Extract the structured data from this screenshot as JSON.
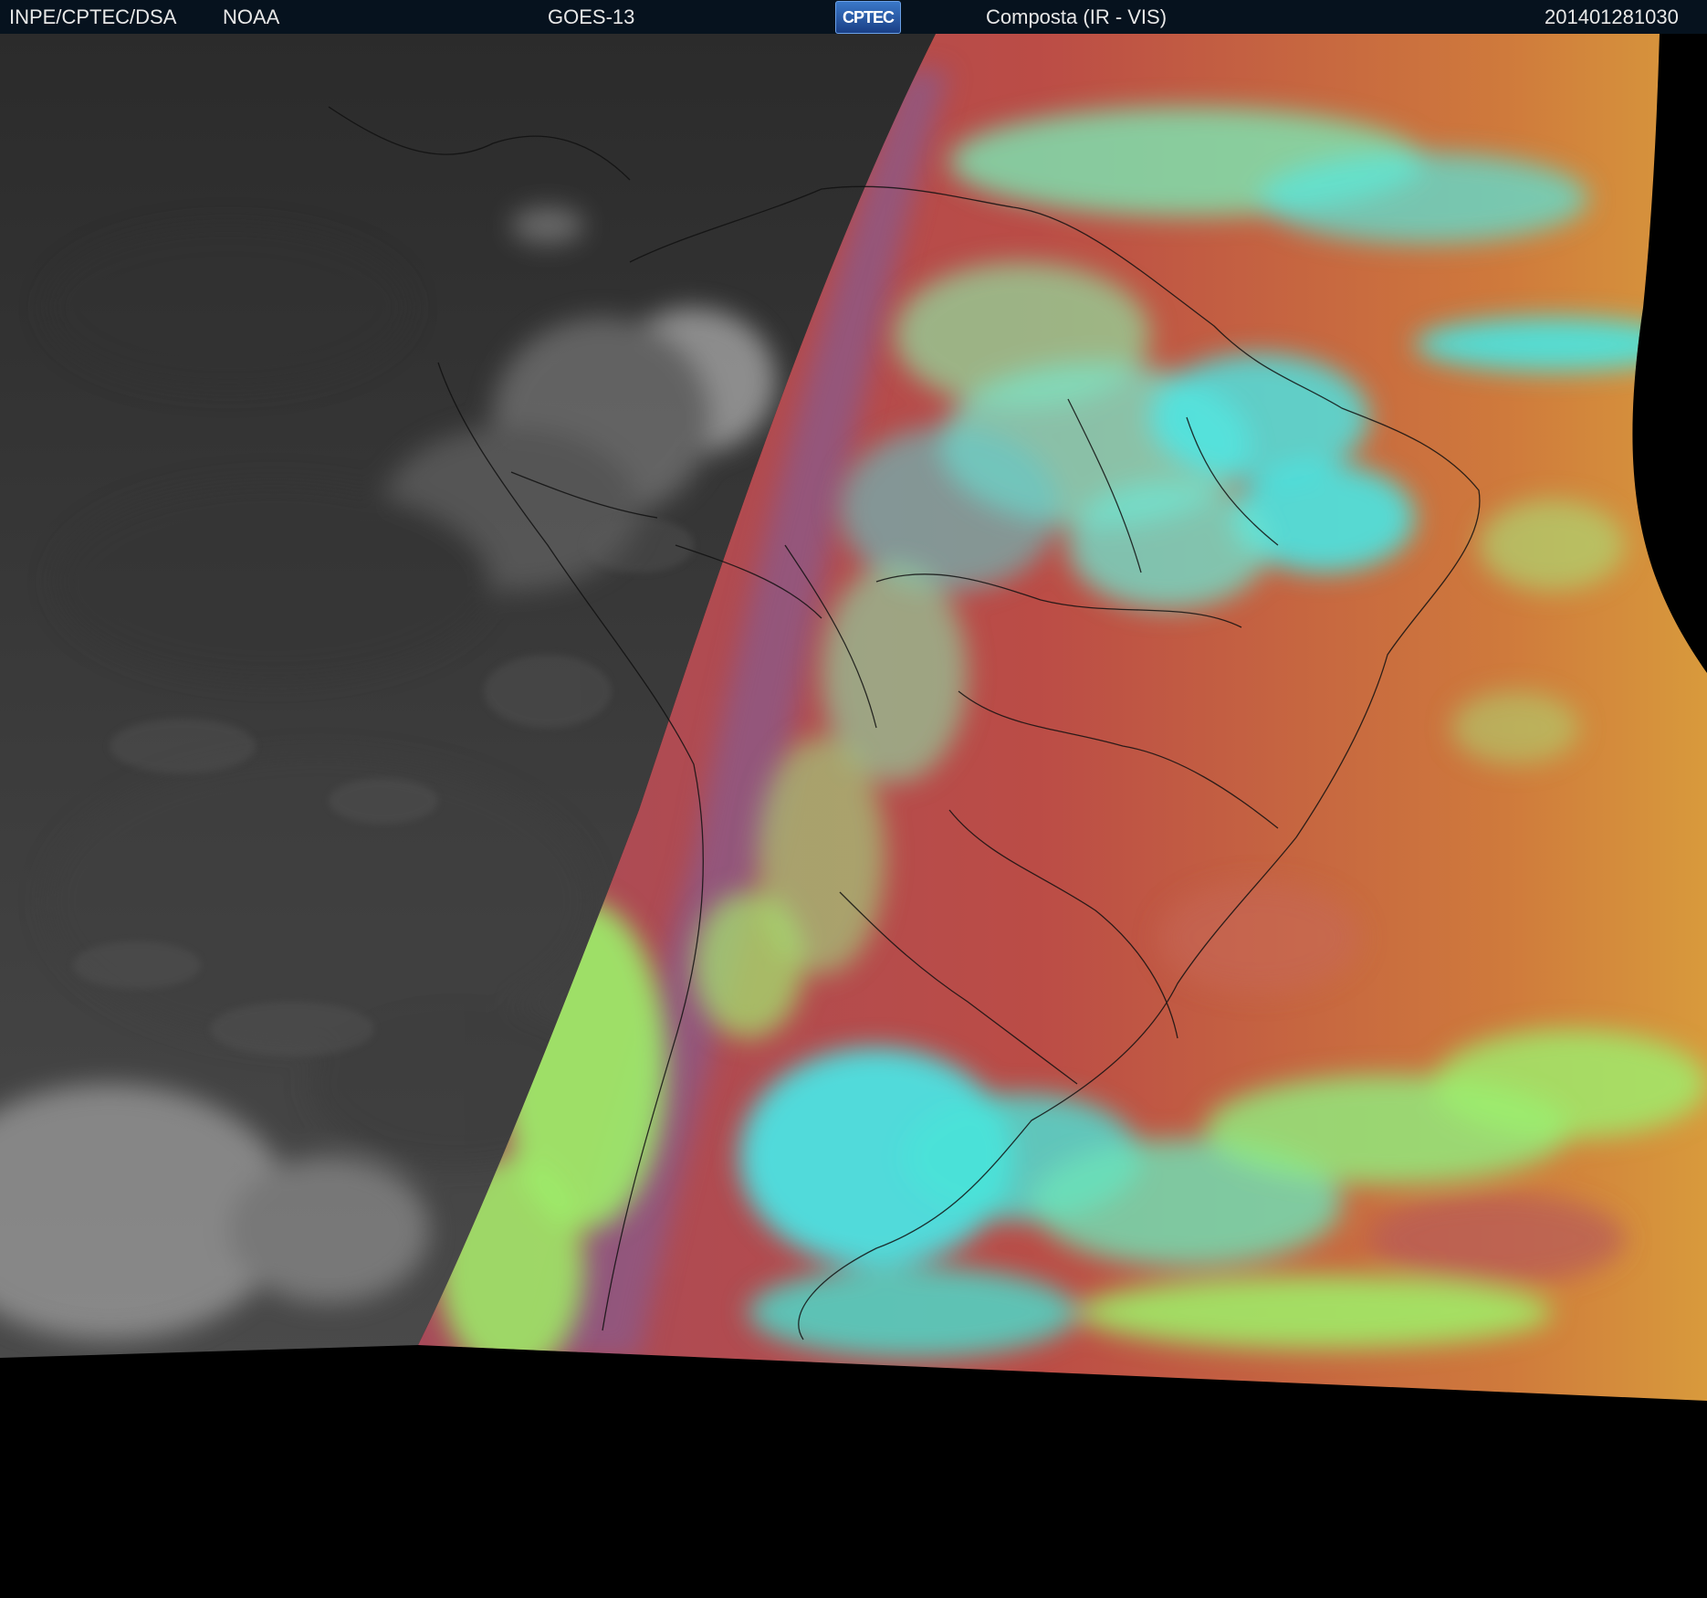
{
  "header": {
    "agency": "INPE/CPTEC/DSA",
    "partner": "NOAA",
    "satellite": "GOES-13",
    "logo_text": "CPTEC",
    "product": "Composta (IR - VIS)",
    "timestamp": "201401281030"
  },
  "colors": {
    "header_bg": "#06121e",
    "night_side": "#3a3a3a",
    "day_land_ocean": "#b84a48",
    "cloud_cyan": "#45eded",
    "cloud_green": "#9ef26a",
    "ocean_orange": "#d68a3a",
    "space": "#000000"
  }
}
